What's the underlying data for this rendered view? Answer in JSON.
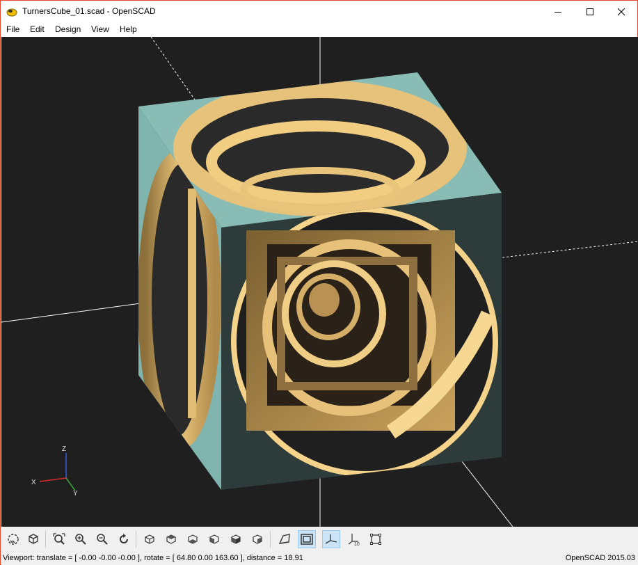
{
  "window": {
    "title": "TurnersCube_01.scad - OpenSCAD"
  },
  "menu": {
    "items": [
      "File",
      "Edit",
      "Design",
      "View",
      "Help"
    ]
  },
  "viewport": {
    "background": "#1f1f1f",
    "face_color": "#f0c878",
    "side_color": "#7fb5ae",
    "axes_labels": {
      "z": "Z",
      "x": "X",
      "y": "Y"
    }
  },
  "toolbar": {
    "buttons": [
      {
        "icon": "preview-icon",
        "active": false
      },
      {
        "icon": "render-icon",
        "active": false
      },
      {
        "icon": "view-all-icon",
        "active": false
      },
      {
        "icon": "zoom-in-icon",
        "active": false
      },
      {
        "icon": "zoom-out-icon",
        "active": false
      },
      {
        "icon": "reset-view-icon",
        "active": false
      },
      {
        "icon": "view-right-icon",
        "active": false
      },
      {
        "icon": "view-top-icon",
        "active": false
      },
      {
        "icon": "view-bottom-icon",
        "active": false
      },
      {
        "icon": "view-left-icon",
        "active": false
      },
      {
        "icon": "view-front-icon",
        "active": false
      },
      {
        "icon": "view-back-icon",
        "active": false
      },
      {
        "icon": "perspective-icon",
        "active": false
      },
      {
        "icon": "orthogonal-icon",
        "active": true
      },
      {
        "icon": "show-axes-icon",
        "active": true
      },
      {
        "icon": "show-scale-markers-icon",
        "active": false
      },
      {
        "icon": "show-edges-icon",
        "active": false
      }
    ]
  },
  "status": {
    "viewport": "Viewport: translate = [ -0.00 -0.00 -0.00 ], rotate = [ 64.80 0.00 163.60 ], distance = 18.91",
    "version": "OpenSCAD 2015.03"
  }
}
